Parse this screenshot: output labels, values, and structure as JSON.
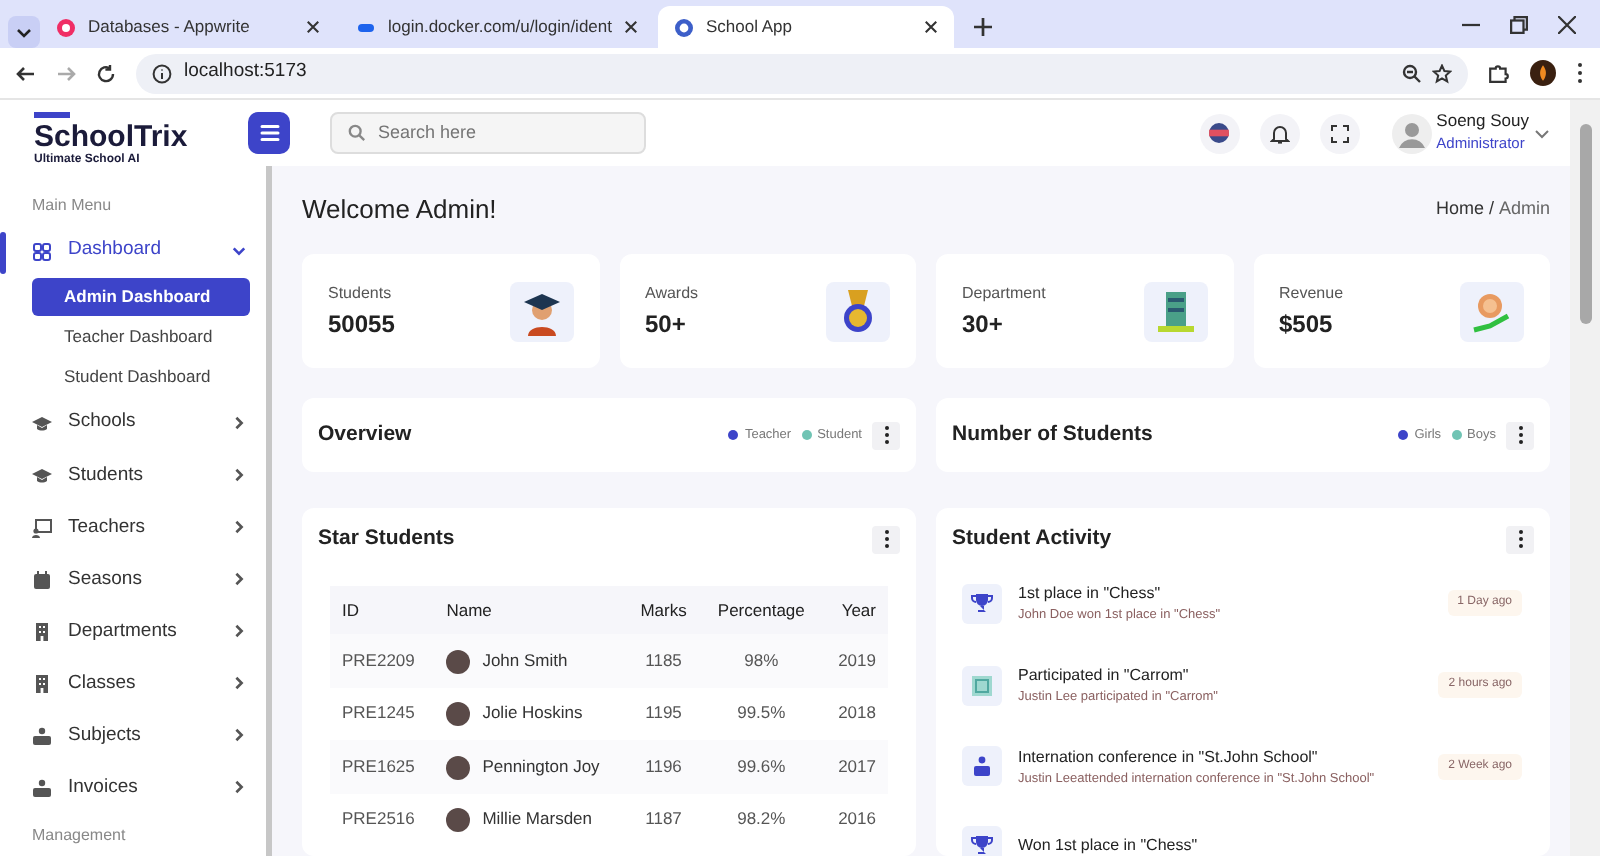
{
  "browser": {
    "tabs": [
      {
        "title": "Databases - Appwrite",
        "kind": "appwrite",
        "selected": false
      },
      {
        "title": "login.docker.com/u/login/ident",
        "kind": "docker",
        "selected": false
      },
      {
        "title": "School App",
        "kind": "app",
        "selected": true
      }
    ],
    "address": "localhost:5173"
  },
  "header": {
    "logo": {
      "name": "SchoolTrix",
      "tagline": "Ultimate School AI"
    },
    "search": {
      "placeholder": "Search here"
    },
    "user": {
      "name": "Soeng Souy",
      "role": "Administrator"
    }
  },
  "sidebar": {
    "section_title": "Main Menu",
    "items": [
      {
        "label": "Dashboard",
        "kind": "grid",
        "selected": true,
        "expanded": true,
        "children": [
          {
            "label": "Admin Dashboard",
            "selected": true
          },
          {
            "label": "Teacher Dashboard",
            "selected": false
          },
          {
            "label": "Student Dashboard",
            "selected": false
          }
        ]
      },
      {
        "label": "Schools",
        "kind": "cap",
        "selected": false,
        "expanded": false
      },
      {
        "label": "Students",
        "kind": "cap",
        "selected": false,
        "expanded": false
      },
      {
        "label": "Teachers",
        "kind": "board",
        "selected": false,
        "expanded": false
      },
      {
        "label": "Seasons",
        "kind": "calendar",
        "selected": false,
        "expanded": false
      },
      {
        "label": "Departments",
        "kind": "building",
        "selected": false,
        "expanded": false
      },
      {
        "label": "Classes",
        "kind": "building",
        "selected": false,
        "expanded": false
      },
      {
        "label": "Subjects",
        "kind": "people",
        "selected": false,
        "expanded": false
      },
      {
        "label": "Invoices",
        "kind": "people",
        "selected": false,
        "expanded": false
      }
    ],
    "section_title_2": "Management"
  },
  "page": {
    "title": "Welcome Admin!",
    "breadcrumb": [
      "Home",
      "Admin"
    ],
    "breadcrumb_separator": "/"
  },
  "stats": [
    {
      "label": "Students",
      "value": "50055",
      "kind": "graduate"
    },
    {
      "label": "Awards",
      "value": "50+",
      "kind": "medal"
    },
    {
      "label": "Department",
      "value": "30+",
      "kind": "building"
    },
    {
      "label": "Revenue",
      "value": "$505",
      "kind": "coin"
    }
  ],
  "panels": [
    {
      "title": "Overview",
      "legend": [
        {
          "label": "Teacher",
          "color": "#3d44c9"
        },
        {
          "label": "Student",
          "color": "#70c4b4"
        }
      ]
    },
    {
      "title": "Number of Students",
      "legend": [
        {
          "label": "Girls",
          "color": "#3d44c9"
        },
        {
          "label": "Boys",
          "color": "#70c4b4"
        }
      ]
    }
  ],
  "star_students": {
    "title": "Star Students",
    "columns": [
      "ID",
      "Name",
      "Marks",
      "Percentage",
      "Year"
    ],
    "rows": [
      [
        "PRE2209",
        "John Smith",
        "1185",
        "98%",
        "2019"
      ],
      [
        "PRE1245",
        "Jolie Hoskins",
        "1195",
        "99.5%",
        "2018"
      ],
      [
        "PRE1625",
        "Pennington Joy",
        "1196",
        "99.6%",
        "2017"
      ],
      [
        "PRE2516",
        "Millie Marsden",
        "1187",
        "98.2%",
        "2016"
      ]
    ]
  },
  "activity": {
    "title": "Student Activity",
    "items": [
      {
        "kind": "trophy",
        "title": "1st place in \"Chess\"",
        "detail": "John Doe won 1st place in \"Chess\"",
        "time": "1 Day ago"
      },
      {
        "kind": "board",
        "title": "Participated in \"Carrom\"",
        "detail": "Justin Lee participated in \"Carrom\"",
        "time": "2 hours ago"
      },
      {
        "kind": "people",
        "title": "Internation conference in \"St.John School\"",
        "detail": "Justin Leeattended internation conference in \"St.John School\"",
        "time": "2 Week ago"
      },
      {
        "kind": "trophy",
        "title": "Won 1st place in \"Chess\""
      }
    ]
  }
}
